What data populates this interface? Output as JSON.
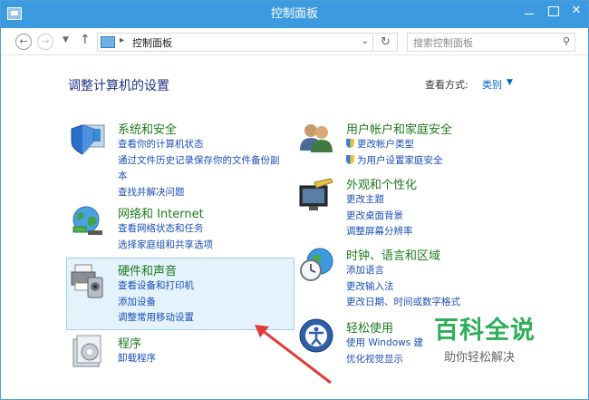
{
  "window": {
    "title": "控制面板"
  },
  "navbar": {
    "address": "控制面板",
    "search_placeholder": "搜索控制面板"
  },
  "content": {
    "heading": "调整计算机的设置",
    "view_by_label": "查看方式:",
    "view_by_value": "类别"
  },
  "categories": {
    "system": {
      "title": "系统和安全",
      "links": [
        "查看你的计算机状态",
        "通过文件历史记录保存你的文件备份副",
        "本",
        "查找并解决问题"
      ]
    },
    "network": {
      "title": "网络和 Internet",
      "links": [
        "查看网络状态和任务",
        "选择家庭组和共享选项"
      ]
    },
    "hardware": {
      "title": "硬件和声音",
      "links": [
        "查看设备和打印机",
        "添加设备",
        "调整常用移动设置"
      ]
    },
    "programs": {
      "title": "程序",
      "links": [
        "卸载程序"
      ]
    },
    "users": {
      "title": "用户帐户和家庭安全",
      "links": [
        "更改帐户类型",
        "为用户设置家庭安全"
      ]
    },
    "appearance": {
      "title": "外观和个性化",
      "links": [
        "更改主题",
        "更改桌面背景",
        "调整屏幕分辨率"
      ]
    },
    "clock": {
      "title": "时钟、语言和区域",
      "links": [
        "添加语言",
        "更改输入法",
        "更改日期、时间或数字格式"
      ]
    },
    "ease": {
      "title": "轻松使用",
      "links": [
        "使用 Windows 建",
        "优化视觉显示"
      ]
    }
  },
  "watermark": {
    "title": "百科全说",
    "subtitle": "助你轻松解决"
  },
  "colors": {
    "titlebar": "#3c9be0",
    "category_title": "#1e7a1e",
    "link": "#1a4fb5",
    "highlight": "#e3f2fb",
    "arrow": "#e23b3b"
  }
}
